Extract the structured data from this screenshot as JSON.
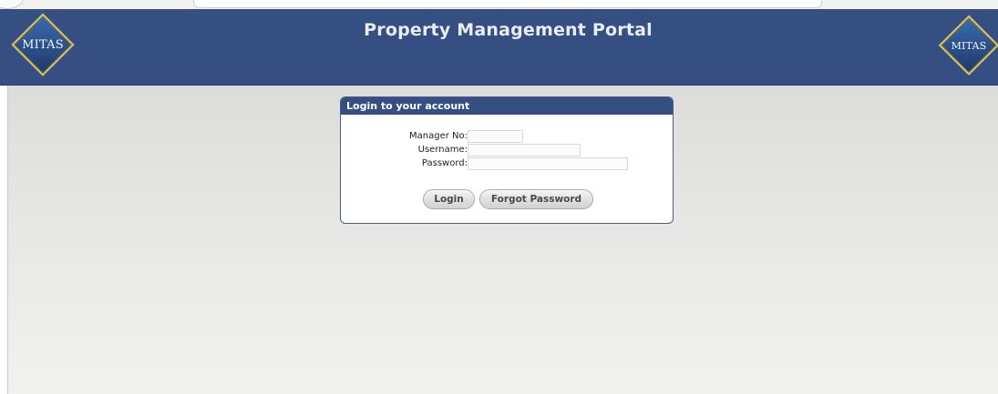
{
  "header": {
    "title": "Property Management Portal",
    "logo_left_text": "MITAS",
    "logo_right_text": "MITAS"
  },
  "login": {
    "panel_title": "Login to your account",
    "manager_no_label": "Manager No:",
    "username_label": "Username:",
    "password_label": "Password:",
    "manager_no_value": "",
    "username_value": "",
    "password_value": "",
    "login_button": "Login",
    "forgot_password_button": "Forgot Password"
  },
  "colors": {
    "header_bg": "#354f82",
    "panel_header_bg": "#354f82",
    "logo_border": "#d8c26a"
  }
}
